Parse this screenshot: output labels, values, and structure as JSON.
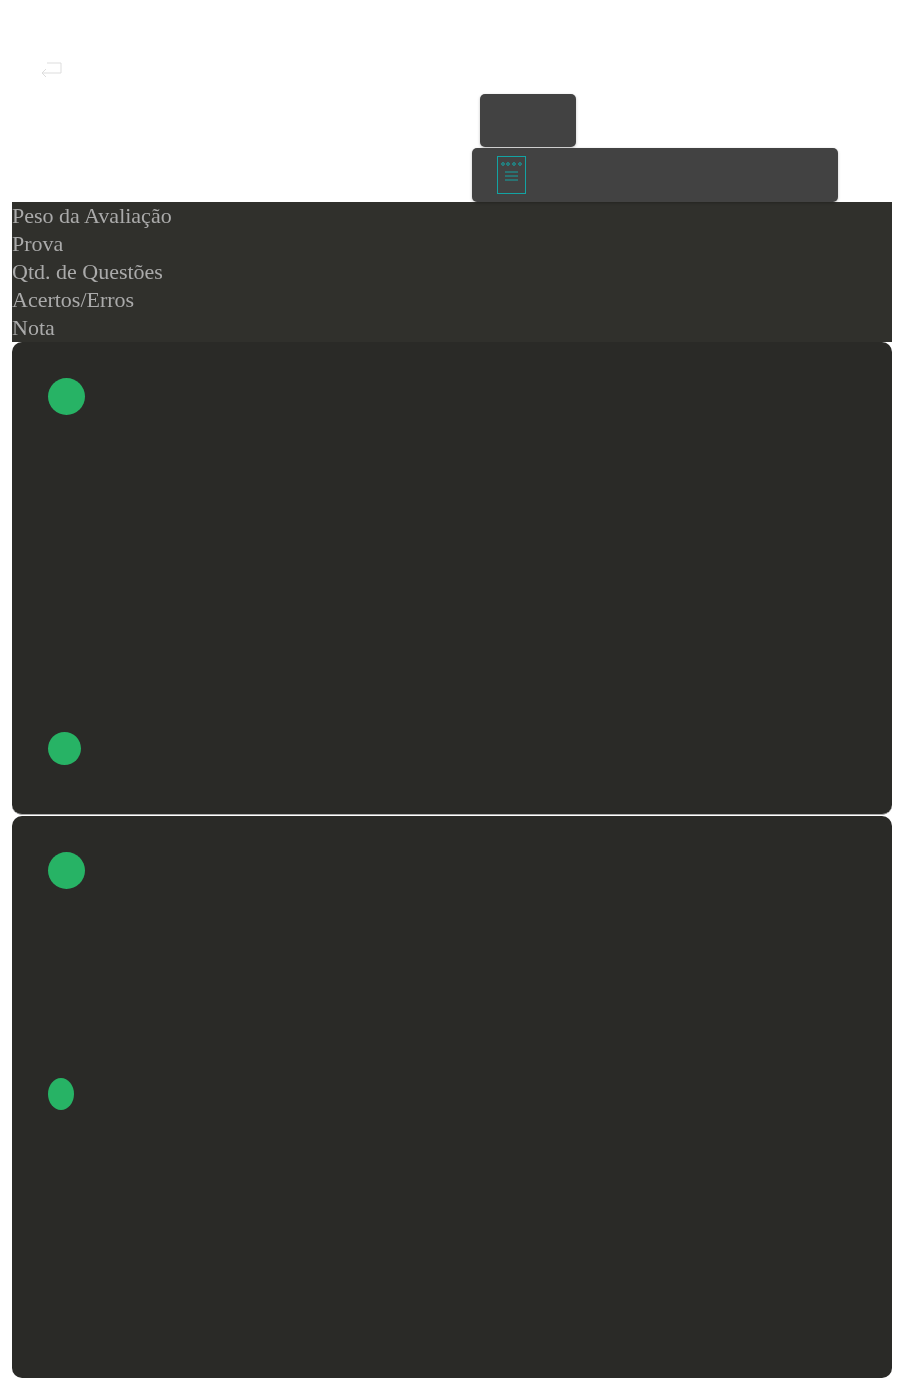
{
  "header": {
    "labels": [
      "Peso da Avaliação",
      "Prova",
      "Qtd. de Questões",
      "Acertos/Erros",
      "Nota"
    ]
  },
  "cards": [
    {
      "kind": "card",
      "dots": [
        {
          "kind": "round"
        },
        {
          "kind": "round"
        }
      ]
    },
    {
      "kind": "card",
      "dots": [
        {
          "kind": "round"
        },
        {
          "kind": "oval"
        }
      ]
    }
  ]
}
